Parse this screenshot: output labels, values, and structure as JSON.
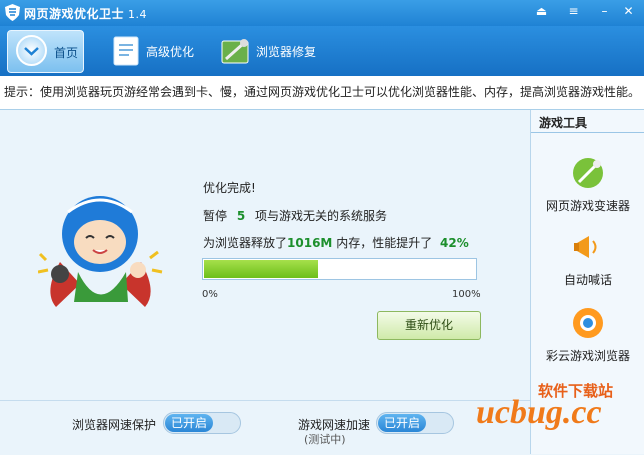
{
  "titlebar": {
    "title": "网页游戏优化卫士",
    "version": "1.4",
    "icons": [
      "shield-icon",
      "restore-icon",
      "menu-icon",
      "close-icon"
    ]
  },
  "toolbar": {
    "items": [
      {
        "label": "首页",
        "icon": "home-icon",
        "active": true
      },
      {
        "label": "高级优化",
        "icon": "document-icon",
        "active": false
      },
      {
        "label": "浏览器修复",
        "icon": "repair-icon",
        "active": false
      }
    ]
  },
  "tip": {
    "text": "提示：使用浏览器玩页游经常会遇到卡、慢，通过网页游戏优化卫士可以优化浏览器性能、内存，提高浏览器游戏性能。"
  },
  "result": {
    "done": "优化完成!",
    "pause_prefix": "暂停",
    "pause_count": "5",
    "pause_suffix": "项与游戏无关的系统服务",
    "mem_prefix": "为浏览器释放了",
    "mem_value": "1016M",
    "mem_mid": "内存，性能提升了",
    "perf_value": "42%",
    "progress_fraction": 0.42,
    "progress_min": "0%",
    "progress_max": "100%",
    "reopt_label": "重新优化"
  },
  "sidebar": {
    "title": "游戏工具",
    "tools": [
      {
        "label": "网页游戏变速器",
        "icon": "speed-icon"
      },
      {
        "label": "自动喊话",
        "icon": "megaphone-icon"
      },
      {
        "label": "彩云游戏浏览器",
        "icon": "browser-icon"
      }
    ]
  },
  "bottom": {
    "browser_protect_label": "浏览器网速保护",
    "browser_protect_state": "已开启",
    "game_accel_label": "游戏网速加速",
    "game_accel_state": "已开启",
    "game_accel_sub": "(测试中)"
  },
  "watermark": {
    "line1": "软件下载站",
    "line2": "ucbug.cc"
  },
  "colors": {
    "accent": "#1f82d4",
    "green": "#1c8f2c",
    "progress": "#7cc61f"
  }
}
